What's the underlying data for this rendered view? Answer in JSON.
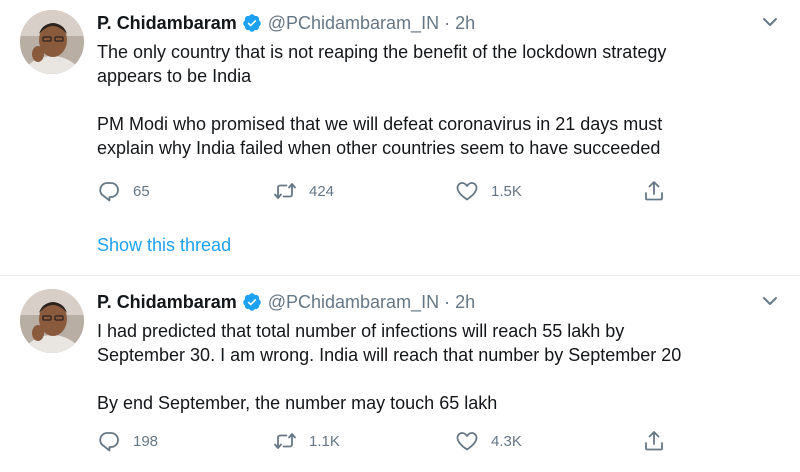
{
  "tweets": [
    {
      "author": {
        "name": "P. Chidambaram",
        "handle": "@PChidambaram_IN",
        "verified": true
      },
      "time": "2h",
      "text": {
        "line1": "The only country that is not reaping the benefit of the lockdown strategy",
        "line2": "appears to be India",
        "line3": "PM Modi who promised that we will defeat coronavirus in 21 days must",
        "line4": "explain why India failed when other countries seem to have succeeded"
      },
      "stats": {
        "replies": "65",
        "retweets": "424",
        "likes": "1.5K"
      },
      "thread_link": "Show this thread"
    },
    {
      "author": {
        "name": "P. Chidambaram",
        "handle": "@PChidambaram_IN",
        "verified": true
      },
      "time": "2h",
      "text": {
        "line1": "I had predicted that total number of infections will reach 55 lakh by",
        "line2": "September 30. I am wrong. India will reach that number by September 20",
        "line3": "By end September, the number may touch 65 lakh"
      },
      "stats": {
        "replies": "198",
        "retweets": "1.1K",
        "likes": "4.3K"
      }
    }
  ],
  "ui": {
    "separator": "·",
    "icons": {
      "reply": "reply-icon",
      "retweet": "retweet-icon",
      "like": "like-icon",
      "share": "share-icon",
      "menu": "chevron-down-icon",
      "verified": "verified-badge-icon"
    },
    "colors": {
      "link": "#1da1f2",
      "muted": "#657786",
      "text": "#14171a",
      "divider": "#e6ecf0"
    }
  }
}
